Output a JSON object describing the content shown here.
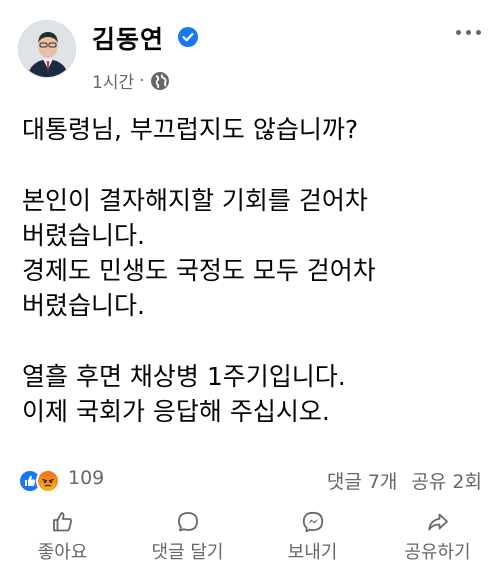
{
  "post": {
    "author": "김동연",
    "time": "1시간",
    "separator": "·",
    "body_lines": [
      "대통령님, 부끄럽지도 않습니까?",
      "",
      "본인이 결자해지할 기회를 걷어차",
      "버렸습니다.",
      "경제도 민생도 국정도 모두 걷어차",
      "버렸습니다.",
      "",
      "열흘 후면 채상병 1주기입니다.",
      "이제 국회가 응답해 주십시오."
    ]
  },
  "stats": {
    "reaction_count": "109",
    "comments": "댓글 7개",
    "shares": "공유 2회"
  },
  "actions": {
    "like": "좋아요",
    "comment": "댓글 달기",
    "send": "보내기",
    "share": "공유하기"
  },
  "colors": {
    "verified": "#1877f2",
    "secondary_text": "#65676b",
    "like_blue": "#1877f2",
    "angry_orange": "#e9710f"
  },
  "icons": {
    "verified": "verified-badge-icon",
    "audience": "globe-icon",
    "more": "more-dots-icon",
    "like": "thumbs-up-icon",
    "comment": "comment-bubble-icon",
    "send": "messenger-icon",
    "share": "share-arrow-icon"
  }
}
